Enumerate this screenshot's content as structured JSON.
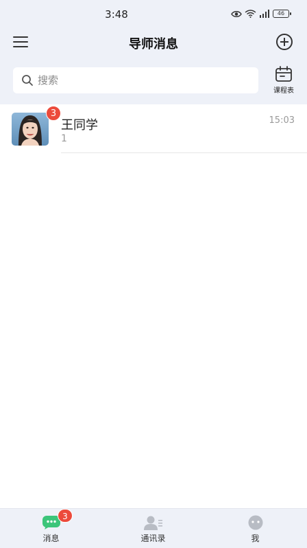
{
  "status_bar": {
    "time": "3:48",
    "battery": "46"
  },
  "header": {
    "title": "导师消息",
    "menu_icon": "hamburger-menu-icon",
    "add_icon": "plus-circle-icon"
  },
  "search": {
    "placeholder": "搜索",
    "value": ""
  },
  "schedule": {
    "label": "课程表",
    "icon": "calendar-icon"
  },
  "chats": [
    {
      "name": "王同学",
      "preview": "1",
      "time": "15:03",
      "unread": "3"
    }
  ],
  "tabs": [
    {
      "label": "消息",
      "icon": "chat-bubble-icon",
      "badge": "3",
      "active": true
    },
    {
      "label": "通讯录",
      "icon": "contacts-icon"
    },
    {
      "label": "我",
      "icon": "profile-icon"
    }
  ],
  "colors": {
    "top_background": "#eef1f8",
    "badge_red": "#ec4a3b",
    "active_tab_green": "#3cc57a",
    "inactive_icon_gray": "#b8bcc4"
  }
}
